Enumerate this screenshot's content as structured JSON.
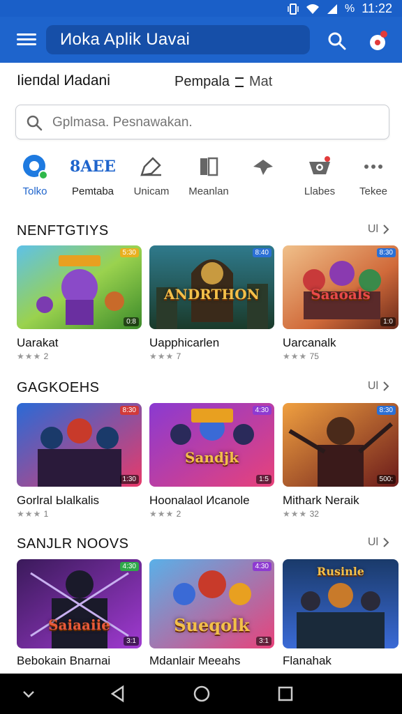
{
  "status_bar": {
    "time": "11:22",
    "battery": "%"
  },
  "app_bar": {
    "title": "Иoka Aplik Uavai"
  },
  "filters": {
    "primary": "Ііепdаl Иadanі",
    "secondary": "Pempala",
    "tertiary": "Mat"
  },
  "search": {
    "placeholder": "Gplmasa. Pesnawakan."
  },
  "categories": [
    {
      "label": "Tolko",
      "icon": "chat-bubble-icon",
      "active": true
    },
    {
      "label": "Pemtaba",
      "icon": "brand-text-icon",
      "brand_text": "8AEE"
    },
    {
      "label": "Unicam",
      "icon": "pencil-icon"
    },
    {
      "label": "Meanlan",
      "icon": "book-icon"
    },
    {
      "label": "",
      "icon": "arrow-icon"
    },
    {
      "label": "Llabes",
      "icon": "gamepad-icon"
    },
    {
      "label": "Tekee",
      "icon": "more-icon"
    }
  ],
  "sections": [
    {
      "title": "NENFTGTIYS",
      "see_all": "Ul",
      "items": [
        {
          "name": "Uarakat",
          "rating": "2",
          "badge": "5:30",
          "downloads": "0:8",
          "art_text": "",
          "badge_color": "#e8b020"
        },
        {
          "name": "Uapphicarlen",
          "rating": "7",
          "badge": "8:40",
          "downloads": "",
          "art_text": "ANDRTHON",
          "badge_color": "#2b70d6"
        },
        {
          "name": "Uarcanalk",
          "rating": "75",
          "badge": "8:30",
          "downloads": "1:0",
          "art_text": "Saaoals",
          "badge_color": "#2b70d6"
        }
      ]
    },
    {
      "title": "GAGKOEHS",
      "see_all": "Ul",
      "items": [
        {
          "name": "Gorlral Ыalkalis",
          "rating": "1",
          "badge": "8:30",
          "downloads": "1:30",
          "art_text": "",
          "badge_color": "#d13a3a"
        },
        {
          "name": "Hoonalaol Иcanole",
          "rating": "2",
          "badge": "4:30",
          "downloads": "1:5",
          "art_text": "Sandjk",
          "badge_color": "#8e3ad1"
        },
        {
          "name": "Mithark Neraik",
          "rating": "32",
          "badge": "8:30",
          "downloads": "500:",
          "art_text": "",
          "badge_color": "#2b70d6"
        }
      ]
    },
    {
      "title": "SANJLR NOOVS",
      "see_all": "Ul",
      "items": [
        {
          "name": "Bebokain Вnarnai",
          "rating": "",
          "badge": "4:30",
          "downloads": "3:1",
          "art_text": "Saiaaiie",
          "badge_color": "#2fa84a"
        },
        {
          "name": "Mdanlair Meeahs",
          "rating": "",
          "badge": "4:30",
          "downloads": "3:1",
          "art_text": "Sueqolk",
          "badge_color": "#8e3ad1"
        },
        {
          "name": "Flanahak",
          "rating": "",
          "badge": "",
          "downloads": "",
          "art_text": "Rusinle",
          "badge_color": "#222222"
        }
      ]
    }
  ],
  "colors": {
    "primary": "#1e64cc",
    "primary_dark": "#164fa8",
    "text": "#111111",
    "muted": "#777777"
  }
}
